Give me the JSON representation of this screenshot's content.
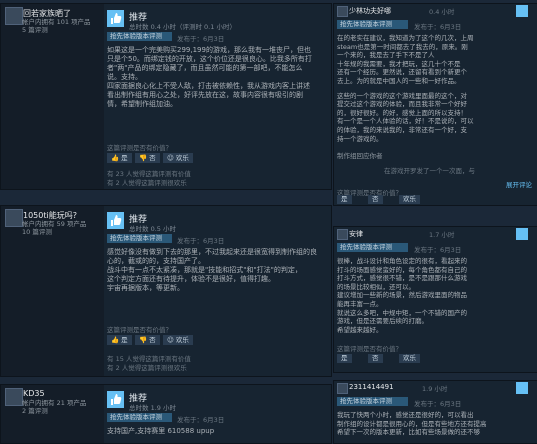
{
  "left": {
    "r1": {
      "user": {
        "name": "回若家族晒了",
        "meta1": "帐户内拥有 101 项产品",
        "meta2": "5 篇评测"
      },
      "title": "推荐",
      "hours": "总时数 0.4 小时（评测时 0.1 小时）",
      "badge": "抢先体验版本评测",
      "posted": "发布于：6月3日",
      "body": [
        "如果这是一个完美购买299,199的游戏，那么我有一堆丧尸，但也",
        "只是个50。而绑定钱的开放，这个价位还是很良心。比我多所有打",
        "者\"两\"产品的绑定隐藏了，而且虽然可能的第一部吧，不能怎么",
        "说。支持。",
        "四家面据良心化上不受人敌，打击被依赖性，我从游戏内客上讲述",
        "看出制作组有用心之处，好评先放在这，故事内容很有吸引的剧",
        "情，希望制作组加油。"
      ],
      "helpful_q": "这篇评测是否有价值？",
      "yes": "是",
      "no": "否",
      "funny": "欢乐",
      "stat1": "有 23 人觉得这篇评测有价值",
      "stat2": "有 2 人觉得这篇评测很欢乐"
    },
    "r2": {
      "user": {
        "name": "1050ti能玩吗?",
        "meta1": "帐户内拥有 59 项产品",
        "meta2": "10 篇评测"
      },
      "title": "推荐",
      "hours": "总时数 0.5 小时",
      "badge": "抢先体验版本评测",
      "posted": "发布于：6月3日",
      "body": [
        "感觉好像没有做到下去的那里，不过我起来还是很宽得到制作组的良",
        "心的，截或的的，支持国产了。",
        "战斗中有一点不太紧凑，那就是\"技能和招式\"和\"打法\"的判定，",
        "这个判定方面还有待提升，体验不是很好，值得打趣。",
        "宇宙再据版本，等更新。"
      ],
      "helpful_q": "这篇评测是否有价值？",
      "yes": "是",
      "no": "否",
      "funny": "欢乐",
      "stat1": "有 15 人觉得这篇评测有价值",
      "stat2": "有 2 人觉得这篇评测很欢乐"
    },
    "r3": {
      "user": {
        "name": "KD35",
        "meta1": "帐户内拥有 21 项产品",
        "meta2": "2 篇评测"
      },
      "title": "推荐",
      "hours": "总时数 1.9 小时",
      "badge": "抢先体验版本评测",
      "posted": "发布于：6月3日",
      "body": [
        "支持国产,支持赛里 610588 upup"
      ]
    }
  },
  "right": {
    "c1": {
      "name": "少林功夫好哪",
      "hours": "0.4 小时",
      "badge": "抢先体验版本评测",
      "posted": "发布于：6月3日",
      "body": [
        "在的老实在建议，我知道为了这个的几次，上周",
        "steam也是第一时间都去了我去的，原来。刚",
        "一个来的，我是去了手下不是了人",
        "十年规的我需要，我才把玩，这几十个不是",
        "还有一个经历。更然说，还留有看到个新更个",
        "去上。为的就是中国人的一些和一好作品。",
        "",
        "这些的一个游戏的这个游戏里面最的这个，对",
        "提交过这个游戏的体验，而且我非常一个好好",
        "的，很好很好。的好，感觉上面的所以支持！",
        "有一个是一个人体验的话，好！不是说的，可以",
        "的体验，我的来说我的，非常还有一个好，支",
        "持一个游戏的。"
      ],
      "extra": "制作组回应你者"
    },
    "c2": {
      "meta": "在游戏开罗发了一个一次面，与",
      "viewall": "展开评论",
      "helpful_q": "这篇评测是否有价值？",
      "yes": "是",
      "no": "否",
      "funny": "欢乐"
    },
    "c3": {
      "name": "安律",
      "hours": "1.7 小时",
      "badge": "抢先体验版本评测",
      "posted": "发布于：6月3日",
      "body": [
        "很棒，战斗设计和角色设定的很有，看起来的",
        "打斗的场面感觉蛮好的，每个角色都有自己的",
        "打斗方式，感觉很不错，是不是跟那什么游戏",
        "的场景比较相似，还可以。",
        "建议增加一些新的场景，然后游戏里面的物品",
        "能再丰富一点。",
        "就说这么多吧，中规中矩，一个不错的国产的",
        "游戏，但是还需要后续的打磨。",
        "希望越来越好。"
      ],
      "helpful_q": "这篇评测是否有价值？",
      "yes": "是",
      "no": "否",
      "funny": "欢乐"
    },
    "c4": {
      "name": "2311414491",
      "hours": "1.9 小时",
      "badge": "抢先体验版本评测",
      "posted": "发布于：6月3日",
      "body": [
        "我玩了快两个小时，感觉还是很好的，可以看出",
        "制作组的设计都是很用心的，但是有些地方还有提高",
        "希望下一次的版本更新，比如有些场景做的还不够"
      ]
    }
  },
  "colors": {
    "bg": "#1b2838",
    "badge": "#2a5878",
    "accent": "#66c0f4"
  }
}
